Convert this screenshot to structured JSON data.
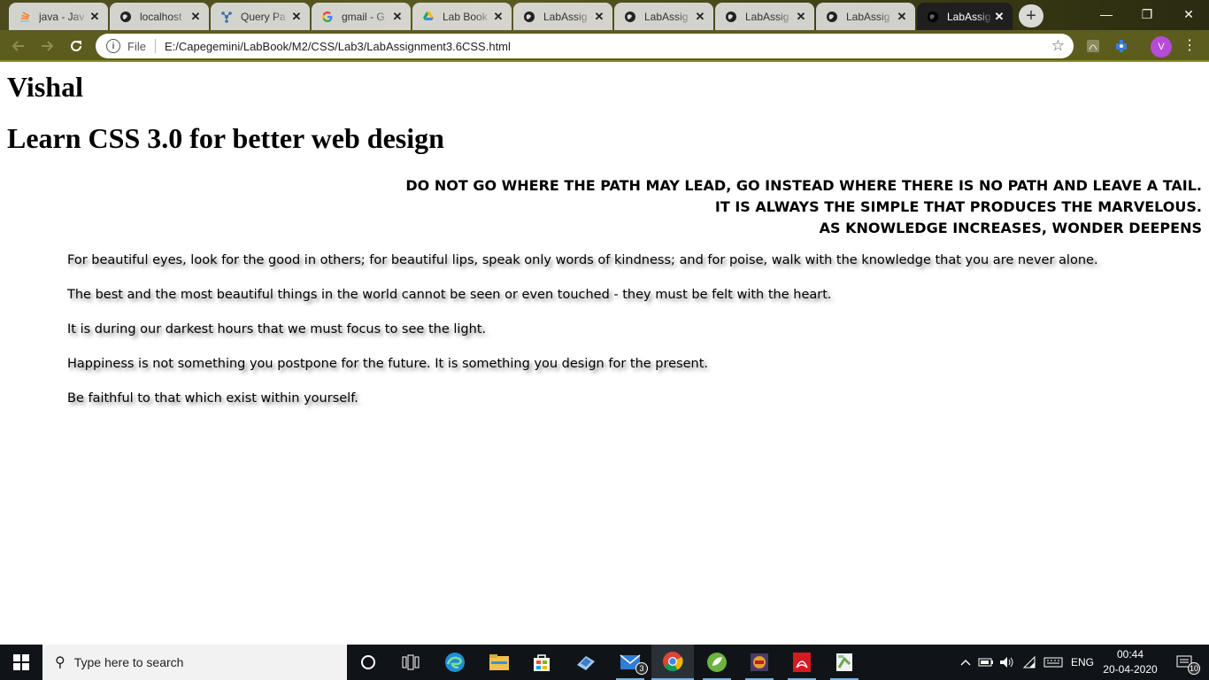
{
  "browser": {
    "tabs": [
      {
        "title": "java - Jav",
        "icon": "stackoverflow-icon",
        "active": false
      },
      {
        "title": "localhost",
        "icon": "globe-icon",
        "active": false
      },
      {
        "title": "Query Pa",
        "icon": "query-icon",
        "active": false
      },
      {
        "title": "gmail - G",
        "icon": "google-icon",
        "active": false
      },
      {
        "title": "Lab Book",
        "icon": "google-drive-icon",
        "active": false
      },
      {
        "title": "LabAssig",
        "icon": "globe-icon",
        "active": false
      },
      {
        "title": "LabAssig",
        "icon": "globe-icon",
        "active": false
      },
      {
        "title": "LabAssig",
        "icon": "globe-icon",
        "active": false
      },
      {
        "title": "LabAssig",
        "icon": "globe-icon",
        "active": false
      },
      {
        "title": "LabAssig",
        "icon": "globe-icon",
        "active": true
      }
    ],
    "address": {
      "scheme": "File",
      "url": "E:/Capegemini/LabBook/M2/CSS/Lab3/LabAssignment3.6CSS.html"
    },
    "profile_initial": "V",
    "window_controls": {
      "minimize": "—",
      "restore": "❐",
      "close": "✕"
    }
  },
  "page": {
    "name_heading": "Vishal",
    "subtitle_heading": "Learn CSS 3.0 for better web design",
    "quotes": [
      "DO NOT GO WHERE THE PATH MAY LEAD, GO INSTEAD WHERE THERE IS NO PATH AND LEAVE A TAIL.",
      "IT IS ALWAYS THE SIMPLE THAT PRODUCES THE MARVELOUS.",
      "AS KNOWLEDGE INCREASES, WONDER DEEPENS"
    ],
    "paragraphs": [
      "For beautiful eyes, look for the good in others; for beautiful lips, speak only words of kindness; and for poise, walk with the knowledge that you are never alone.",
      "The best and the most beautiful things in the world cannot be seen or even touched - they must be felt with the heart.",
      "It is during our darkest hours that we must focus to see the light.",
      "Happiness is not something you postpone for the future. It is something you design for the present.",
      "Be faithful to that which exist within yourself."
    ]
  },
  "taskbar": {
    "search_placeholder": "Type here to search",
    "mail_badge": "3",
    "language": "ENG",
    "time": "00:44",
    "date": "20-04-2020",
    "notification_count": "10"
  },
  "colors": {
    "tabstrip": "#4a4a1e",
    "toolbar": "#5d5c1f",
    "taskbar": "#101418",
    "text_shadow": "#7a7a7a"
  }
}
